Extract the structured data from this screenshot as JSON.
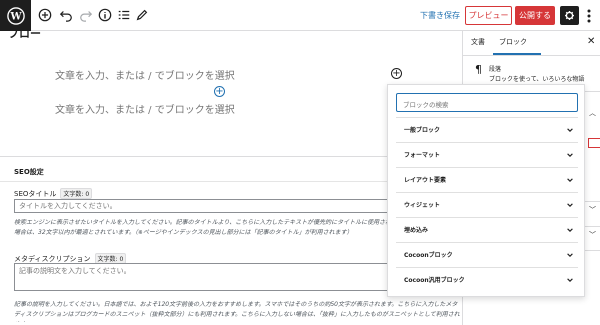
{
  "toolbar": {
    "save_draft": "下書き保存",
    "preview": "プレビュー",
    "publish": "公開する",
    "icons": [
      "wordpress-icon",
      "add-block-icon",
      "undo-icon",
      "redo-icon",
      "info-icon",
      "list-view-icon",
      "edit-icon",
      "gear-icon",
      "more-icon"
    ]
  },
  "editor": {
    "title_fragment": "ブロー",
    "placeholder_1": "文章を入力、または / でブロックを選択",
    "placeholder_2": "文章を入力、または / でブロックを選択"
  },
  "seo": {
    "heading": "SEO設定",
    "title_label": "SEOタイトル",
    "title_count": "文字数: 0",
    "title_placeholder": "タイトルを入力してください。",
    "title_help": "検索エンジンに表示させたいタイトルを入力してください。記事のタイトルより、こちらに入力したテキストが優先的にタイトルに使用されます。一般的に日本語の場合は、32文字以内が最適とされています。（※ページやインデックスの見出し部分には「記事のタイトル」が利用されます）",
    "desc_label": "メタディスクリプション",
    "desc_count": "文字数: 0",
    "desc_placeholder": "記事の説明文を入力してください。",
    "desc_help": "記事の説明を入力してください。日本語では、およそ120文字前後の入力をおすすめします。スマホではそのうちの約50文字が表示されます。こちらに入力したメタディスクリプションはブログカードのスニペット（抜粋文部分）にも利用されます。こちらに入力しない場合は、「抜粋」に入力したものがスニペットとして利用されます。"
  },
  "sidebar": {
    "tab_document": "文書",
    "tab_block": "ブロック",
    "block_name": "段落",
    "block_desc": "ブロックを使って、いろいろな物語"
  },
  "inserter": {
    "search_placeholder": "ブロックの検索",
    "categories": [
      {
        "label": "一般ブロック"
      },
      {
        "label": "フォーマット"
      },
      {
        "label": "レイアウト要素"
      },
      {
        "label": "ウィジェット"
      },
      {
        "label": "埋め込み"
      },
      {
        "label": "Cocoonブロック"
      },
      {
        "label": "Cocoon汎用ブロック"
      }
    ]
  },
  "colors": {
    "accent": "#2271b1",
    "danger": "#d63638",
    "dark": "#1e1e1e"
  }
}
